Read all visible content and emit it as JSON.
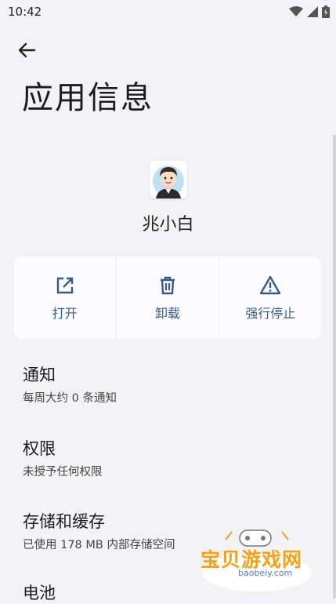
{
  "status_bar": {
    "time": "10:42"
  },
  "page": {
    "title": "应用信息"
  },
  "app": {
    "name": "兆小白"
  },
  "actions": [
    {
      "label": "打开",
      "icon": "open-external-icon"
    },
    {
      "label": "卸载",
      "icon": "trash-icon"
    },
    {
      "label": "强行停止",
      "icon": "warning-icon"
    }
  ],
  "settings": [
    {
      "title": "通知",
      "subtitle": "每周大约 0 条通知"
    },
    {
      "title": "权限",
      "subtitle": "未授予任何权限"
    },
    {
      "title": "存储和缓存",
      "subtitle": "已使用 178 MB 内部存储空间"
    },
    {
      "title": "电池"
    }
  ],
  "watermark": {
    "text": "宝贝游戏网",
    "domain": "baobeiy.com"
  },
  "colors": {
    "background": "#f3f3f6",
    "accent": "#3a5a85",
    "card": "#fcfcff"
  }
}
